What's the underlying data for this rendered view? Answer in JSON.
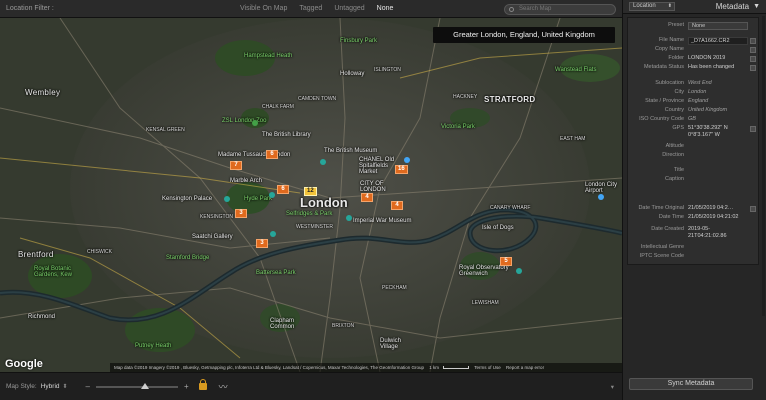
{
  "filter_bar": {
    "title": "Location Filter :",
    "options": [
      "Visible On Map",
      "Tagged",
      "Untagged",
      "None"
    ],
    "active_option": "None",
    "search_placeholder": "Search Map"
  },
  "map": {
    "tooltip": "Greater London, England, United Kingdom",
    "labels": {
      "wembley": "Wembley",
      "hampstead_heath": "Hampstead Heath",
      "finsbury_park": "Finsbury Park",
      "wanstead_flats": "Wanstead Flats",
      "stratford": "STRATFORD",
      "holloway": "Holloway",
      "camden_town": "CAMDEN TOWN",
      "chalk_farm": "CHALK FARM",
      "kensal_green": "KENSAL GREEN",
      "zsl": "ZSL London Zoo",
      "british_library": "The British Library",
      "british_museum": "The British Museum",
      "madame_tussauds": "Madame Tussauds London",
      "victoria_park": "Victoria Park",
      "chanel": "CHANEL Old Spitalfields Market",
      "marble_arch": "Marble Arch",
      "city_of_london": "CITY OF LONDON",
      "london": "London",
      "kensington_palace": "Kensington Palace",
      "hyde_park": "Hyde Park",
      "selfridges": "Selfridges & Park",
      "kensington": "KENSINGTON",
      "westminster": "WESTMINSTER",
      "saatchi": "Saatchi Gallery",
      "imperial_war_museum": "Imperial War Museum",
      "isle_of_dogs": "Isle of Dogs",
      "canary_wharf": "CANARY WHARF",
      "london_city_airport": "London City Airport",
      "stamford_bridge": "Stamford Bridge",
      "battersea_park": "Battersea Park",
      "brentford": "Brentford",
      "royal_botanic": "Royal Botanic Gardens, Kew",
      "chiswick": "CHISWICK",
      "richmond": "Richmond",
      "clapham": "Clapham Common",
      "peckham": "PECKHAM",
      "royal_observatory": "Royal Observatory Greenwich",
      "lewisham": "LEWISHAM",
      "putney_heath": "Putney Heath",
      "dulwich": "Dulwich Village",
      "brixton": "BRIXTON",
      "east_ham": "EAST HAM",
      "hackney": "HACKNEY",
      "islington": "ISLINGTON"
    },
    "markers": [
      {
        "id": "m6",
        "count": "6"
      },
      {
        "id": "m7",
        "count": "7"
      },
      {
        "id": "m16",
        "count": "16"
      },
      {
        "id": "m6b",
        "count": "6"
      },
      {
        "id": "m12",
        "count": "12"
      },
      {
        "id": "m4a",
        "count": "4"
      },
      {
        "id": "m4b",
        "count": "4"
      },
      {
        "id": "m3a",
        "count": "3"
      },
      {
        "id": "m3b",
        "count": "3"
      },
      {
        "id": "m5",
        "count": "5"
      }
    ],
    "google": "Google",
    "attribution": "Map data ©2019 Imagery ©2019 , Bluesky, Getmapping plc, Infoterra Ltd & Bluesky, Landsat / Copernicus, Maxar Technologies, The GeoInformation Group",
    "scale": "1 km",
    "terms": "Terms of Use",
    "report": "Report a map error",
    "colors": {
      "marker": "#e06a1e",
      "marker_selected": "#f3c43a",
      "park": "#4caf50"
    }
  },
  "bottom_bar": {
    "map_style_label": "Map Style:",
    "map_style_value": "Hybrid",
    "zoom_minus": "–",
    "zoom_plus": "+",
    "zoom_level": 0.6
  },
  "panel": {
    "location_select": "Location",
    "title": "Metadata",
    "preset": {
      "key": "Preset",
      "value": "None"
    },
    "fields": [
      {
        "key": "File Name",
        "value": "_D7A1662.CR2"
      },
      {
        "key": "Copy Name",
        "value": ""
      },
      {
        "key": "Folder",
        "value": "LONDON 2019"
      },
      {
        "key": "Metadata Status",
        "value": "Has been changed"
      },
      {
        "key": "Sublocation",
        "value": "West End"
      },
      {
        "key": "City",
        "value": "London"
      },
      {
        "key": "State / Province",
        "value": "England"
      },
      {
        "key": "Country",
        "value": "United Kingdom"
      },
      {
        "key": "ISO Country Code",
        "value": "GB"
      },
      {
        "key": "GPS",
        "value": "51°30'38.292\" N 0°8'3.167\" W"
      },
      {
        "key": "Altitude",
        "value": ""
      },
      {
        "key": "Direction",
        "value": ""
      },
      {
        "key": "Title",
        "value": ""
      },
      {
        "key": "Caption",
        "value": ""
      },
      {
        "key": "Date Time Original",
        "value": "21/05/2019 04:2…"
      },
      {
        "key": "Date Time",
        "value": "21/05/2019 04:21:02"
      },
      {
        "key": "Date Created",
        "value": "2019-05-21T04:21:02.86"
      },
      {
        "key": "Intellectual Genre",
        "value": ""
      },
      {
        "key": "IPTC Scene Code",
        "value": ""
      }
    ],
    "sync_button": "Sync Metadata"
  }
}
